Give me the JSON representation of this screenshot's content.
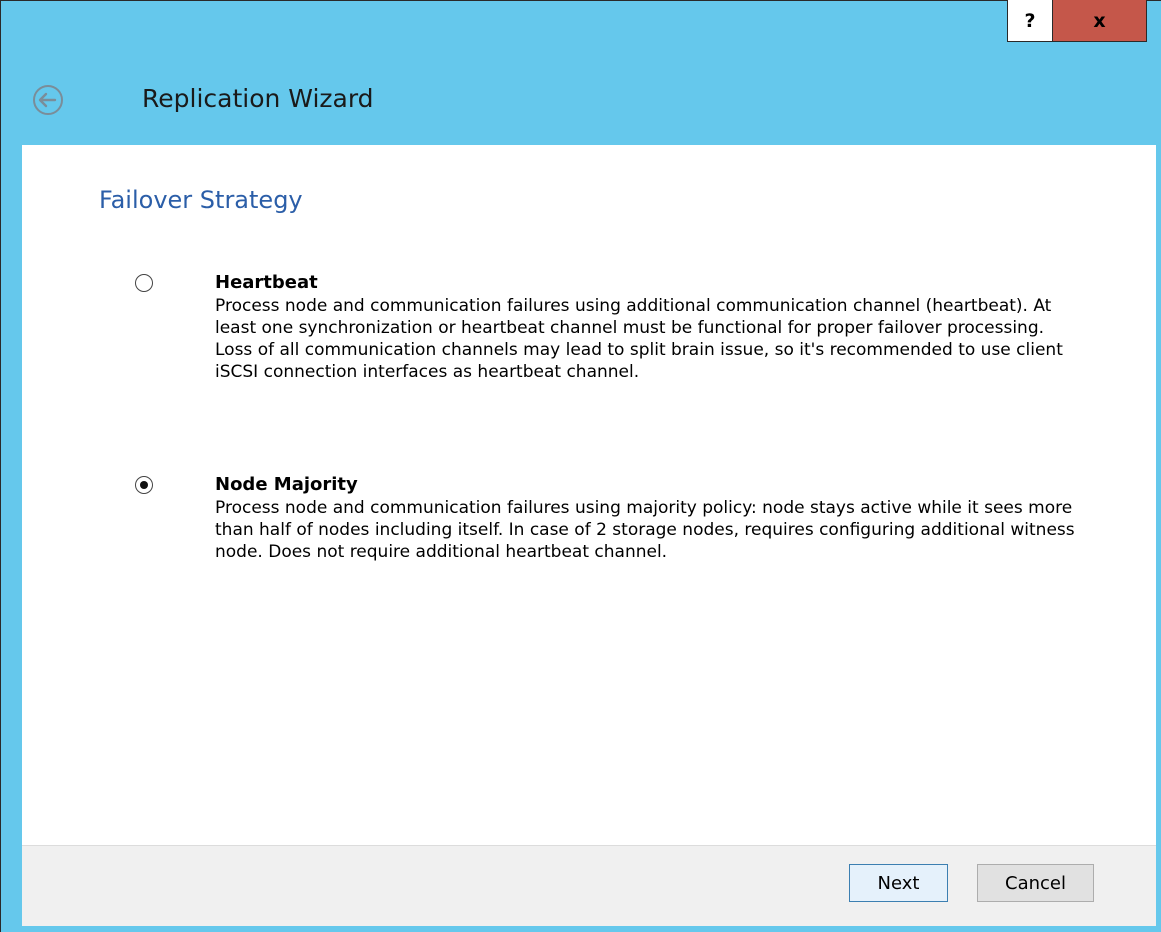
{
  "window": {
    "title": "Replication Wizard",
    "help_label": "?",
    "close_label": "x",
    "colors": {
      "frame": "#65c8ec",
      "close": "#c5574a",
      "accent": "#2b5ea8"
    }
  },
  "page": {
    "section_title": "Failover Strategy"
  },
  "options": [
    {
      "title": "Heartbeat",
      "selected": false,
      "description": "Process node and communication failures using additional communication channel (heartbeat). At least one synchronization or heartbeat channel must be functional for proper failover processing. Loss of all communication channels may lead to split brain issue, so it's recommended to use client iSCSI connection interfaces as heartbeat channel."
    },
    {
      "title": "Node Majority",
      "selected": true,
      "description": "Process node and communication failures using majority policy: node stays active while it sees more than half of nodes including itself. In case of 2 storage nodes, requires configuring additional witness node. Does not require additional heartbeat channel."
    }
  ],
  "footer": {
    "next_label": "Next",
    "cancel_label": "Cancel"
  }
}
